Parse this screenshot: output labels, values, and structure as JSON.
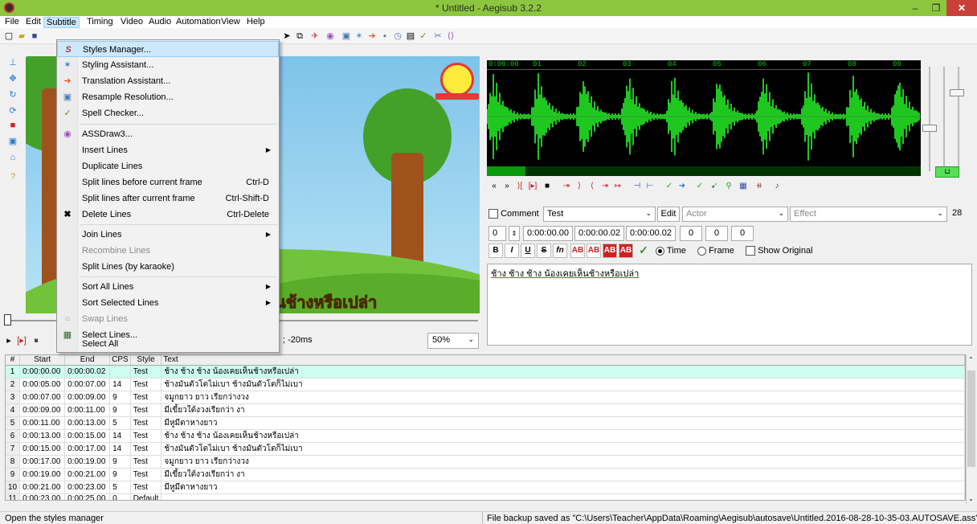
{
  "window": {
    "title": "* Untitled - Aegisub 3.2.2",
    "minimize": "–",
    "maximize": "❐",
    "close": "✕"
  },
  "menubar": [
    "File",
    "Edit",
    "Subtitle",
    "Timing",
    "Video",
    "Audio",
    "Automation",
    "View",
    "Help"
  ],
  "subtitle_menu": {
    "items": [
      {
        "label": "Styles Manager...",
        "icon": "styles-icon",
        "glyph": "S",
        "shortcut": ""
      },
      {
        "label": "Styling Assistant...",
        "icon": "styling-assistant-icon",
        "glyph": "✶",
        "shortcut": ""
      },
      {
        "label": "Translation Assistant...",
        "icon": "translation-icon",
        "glyph": "➜",
        "shortcut": ""
      },
      {
        "label": "Resample Resolution...",
        "icon": "resample-icon",
        "glyph": "▣",
        "shortcut": ""
      },
      {
        "label": "Spell Checker...",
        "icon": "spellcheck-icon",
        "glyph": "✓",
        "shortcut": ""
      },
      {
        "label": "ASSDraw3...",
        "icon": "assdraw-icon",
        "glyph": "◉",
        "shortcut": ""
      },
      {
        "label": "Insert Lines",
        "shortcut": ""
      },
      {
        "label": "Duplicate Lines",
        "shortcut": ""
      },
      {
        "label": "Split lines before current frame",
        "shortcut": "Ctrl-D"
      },
      {
        "label": "Split lines after current frame",
        "shortcut": "Ctrl-Shift-D"
      },
      {
        "label": "Delete Lines",
        "icon": "delete-icon",
        "glyph": "✖",
        "shortcut": "Ctrl-Delete"
      },
      {
        "label": "Join Lines",
        "shortcut": ""
      },
      {
        "label": "Recombine Lines",
        "shortcut": ""
      },
      {
        "label": "Split Lines (by karaoke)",
        "shortcut": ""
      },
      {
        "label": "Sort All Lines",
        "shortcut": ""
      },
      {
        "label": "Sort Selected Lines",
        "shortcut": ""
      },
      {
        "label": "Swap Lines",
        "icon": "swap-icon",
        "glyph": "○",
        "shortcut": ""
      },
      {
        "label": "Select Lines...",
        "icon": "select-lines-icon",
        "glyph": "▦",
        "shortcut": ""
      },
      {
        "label": "Select All",
        "shortcut": ""
      }
    ]
  },
  "video": {
    "subtitle_overlay": "ันช้างหรือเปล่า",
    "zoom": "50%",
    "offset": "; -20ms"
  },
  "waveform": {
    "ticks": [
      "0:00:00",
      "01",
      "02",
      "03",
      "04",
      "05",
      "06",
      "07",
      "08",
      "09"
    ]
  },
  "edit": {
    "comment_label": "Comment",
    "style": "Test",
    "edit_button": "Edit",
    "actor_placeholder": "Actor",
    "effect_placeholder": "Effect",
    "margin_right": "28",
    "layer": "0",
    "start_time": "0:00:00.00",
    "end_time": "0:00:00.02",
    "duration": "0:00:00.02",
    "margin_l": "0",
    "margin_r": "0",
    "margin_v": "0",
    "fmt": {
      "bold": "B",
      "italic": "I",
      "underline": "U",
      "strike": "S",
      "fn": "fn",
      "ab1": "AB",
      "ab2": "AB",
      "ab3": "AB",
      "ab4": "AB",
      "commit": "✓"
    },
    "time_label": "Time",
    "frame_label": "Frame",
    "show_original_label": "Show Original",
    "text": "ช้าง ช้าง ช้าง น้องเคยเห็นช้างหรือเปล่า"
  },
  "grid": {
    "headers": [
      "#",
      "Start",
      "End",
      "CPS",
      "Style",
      "Text"
    ],
    "rows": [
      [
        "1",
        "0:00:00.00",
        "0:00:00.02",
        "",
        "Test",
        "ช้าง ช้าง ช้าง น้องเคยเห็นช้างหรือเปล่า"
      ],
      [
        "2",
        "0:00:05.00",
        "0:00:07.00",
        "14",
        "Test",
        "ช้างมันตัวโตไม่เบา ช้างมันตัวโตก็ไม่เบา"
      ],
      [
        "3",
        "0:00:07.00",
        "0:00:09.00",
        "9",
        "Test",
        "จมูกยาว ยาว เรียกว่างวง"
      ],
      [
        "4",
        "0:00:09.00",
        "0:00:11.00",
        "9",
        "Test",
        "มีเขี้ยวใต้งวงเรียกว่า งา"
      ],
      [
        "5",
        "0:00:11.00",
        "0:00:13.00",
        "5",
        "Test",
        "มีหูมีตาหางยาว"
      ],
      [
        "6",
        "0:00:13.00",
        "0:00:15.00",
        "14",
        "Test",
        "ช้าง ช้าง ช้าง น้องเคยเห็นช้างหรือเปล่า"
      ],
      [
        "7",
        "0:00:15.00",
        "0:00:17.00",
        "14",
        "Test",
        "ช้างมันตัวโตไม่เบา ช้างมันตัวโตก็ไม่เบา"
      ],
      [
        "8",
        "0:00:17.00",
        "0:00:19.00",
        "9",
        "Test",
        "จมูกยาว ยาว เรียกว่างวง"
      ],
      [
        "9",
        "0:00:19.00",
        "0:00:21.00",
        "9",
        "Test",
        "มีเขี้ยวใต้งวงเรียกว่า งา"
      ],
      [
        "10",
        "0:00:21.00",
        "0:00:23.00",
        "5",
        "Test",
        "มีหูมีตาหางยาว"
      ],
      [
        "11",
        "0:00:23.00",
        "0:00:25.00",
        "0",
        "Default",
        ""
      ]
    ]
  },
  "status": {
    "left": "Open the styles manager",
    "right": "File backup saved as \"C:\\Users\\Teacher\\AppData\\Roaming\\Aegisub\\autosave\\Untitled.2016-08-28-10-35-03.AUTOSAVE.ass\"."
  }
}
